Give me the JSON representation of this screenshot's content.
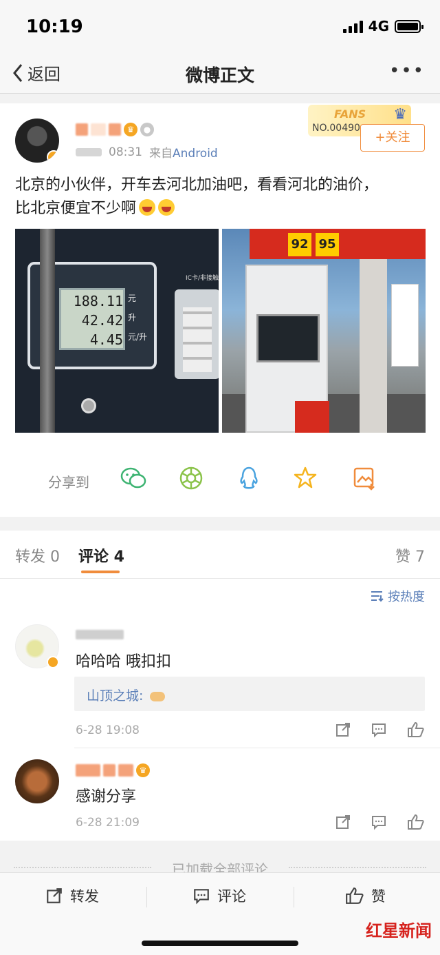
{
  "status_bar": {
    "time": "10:19",
    "network": "4G"
  },
  "nav": {
    "back_label": "返回",
    "title": "微博正文"
  },
  "post": {
    "timestamp": "08:31",
    "source_prefix": "来自",
    "source": "Android",
    "fans_badge_title": "FANS",
    "fans_badge_number": "NO.00490",
    "follow_label": "+关注",
    "text_line1": "北京的小伙伴，开车去河北加油吧，看看河北的油价，",
    "text_line2": "比北京便宜不少啊",
    "photo1": {
      "amount": "188.11",
      "volume": "42.42",
      "price": "4.45",
      "unit_yuan": "元",
      "unit_liter": "升",
      "unit_price": "元/升",
      "card_label": "IC卡/非接触"
    },
    "photo2": {
      "grade1": "92",
      "grade2": "95"
    },
    "share_label": "分享到"
  },
  "tabs": {
    "repost": "转发 0",
    "comment": "评论 4",
    "like": "赞 7"
  },
  "sort_label": "按热度",
  "comments": [
    {
      "text": "哈哈哈 哦扣扣",
      "reply_author": "山顶之城:",
      "time": "6-28 19:08"
    },
    {
      "text": "感谢分享",
      "time": "6-28 21:09"
    }
  ],
  "loaded_label": "已加载全部评论",
  "bottom_bar": {
    "repost": "转发",
    "comment": "评论",
    "like": "赞"
  },
  "watermark": "红星新闻",
  "colors": {
    "accent_orange": "#f08c3c",
    "link_blue": "#5b7fb8",
    "watermark_red": "#d6231e"
  }
}
